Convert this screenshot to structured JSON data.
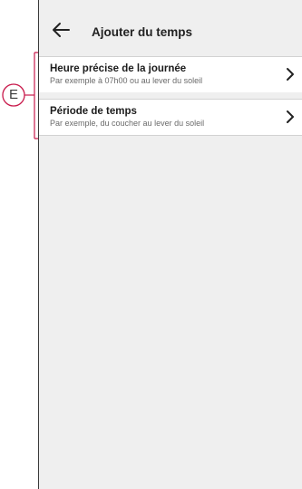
{
  "callout": {
    "letter": "E",
    "color": "#c8194b"
  },
  "header": {
    "title": "Ajouter du temps",
    "back_icon": "arrow-left-icon"
  },
  "options": [
    {
      "title": "Heure précise de la journée",
      "subtitle": "Par exemple à 07h00 ou au lever du soleil",
      "icon": "chevron-right-icon"
    },
    {
      "title": "Période de temps",
      "subtitle": "Par exemple, du coucher au lever du soleil",
      "icon": "chevron-right-icon"
    }
  ]
}
